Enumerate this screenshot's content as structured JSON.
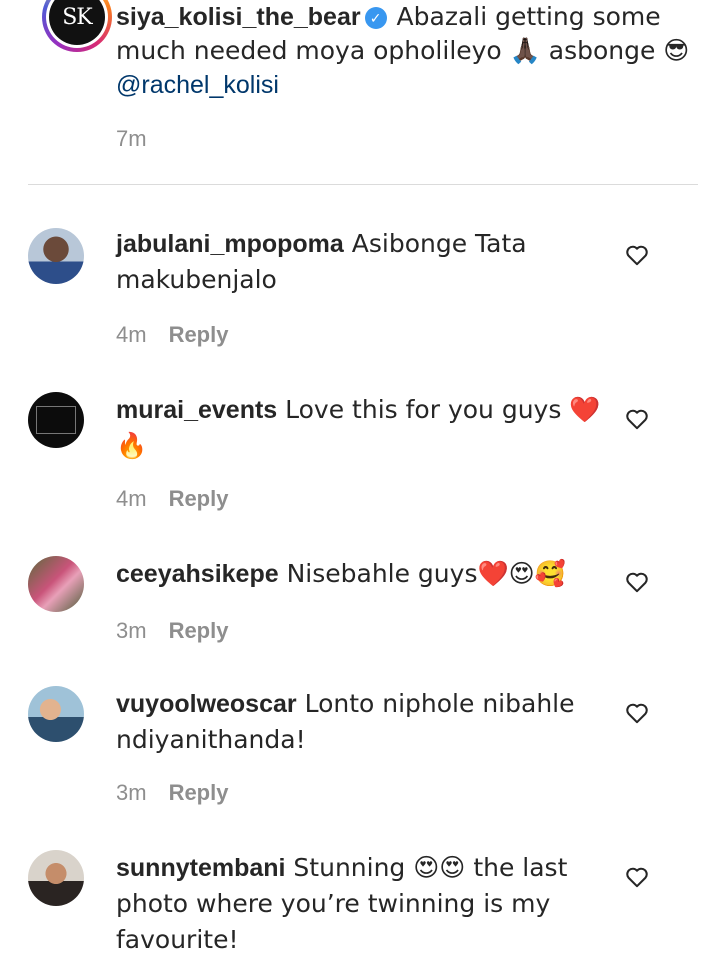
{
  "caption": {
    "avatar_text": "SK",
    "username": "siya_kolisi_the_bear",
    "verified_icon": "verified-badge-icon",
    "text": " Abazali getting some much needed moya opholileyo 🙏🏿 asbonge 😎 ",
    "mention": "@rachel_kolisi",
    "time": "7m"
  },
  "comments": [
    {
      "username": "jabulani_mpopoma",
      "text": " Asibonge Tata makubenjalo",
      "time": "4m",
      "reply": "Reply"
    },
    {
      "username": "murai_events",
      "text": " Love this for you guys ❤️ 🔥",
      "time": "4m",
      "reply": "Reply"
    },
    {
      "username": "ceeyahsikepe",
      "text": " Nisebahle guys❤️😍🥰",
      "time": "3m",
      "reply": "Reply"
    },
    {
      "username": "vuyoolweoscar",
      "text": " Lonto niphole nibahle ndiyanithanda!",
      "time": "3m",
      "reply": "Reply"
    },
    {
      "username": "sunnytembani",
      "text": " Stunning 😍😍 the last photo where you’re twinning is my favourite!",
      "time": "",
      "reply": ""
    }
  ],
  "icons": {
    "like": "heart-outline-icon"
  },
  "colors": {
    "mention": "#00376b",
    "verified": "#3897f0",
    "meta": "#8e8e8e"
  }
}
